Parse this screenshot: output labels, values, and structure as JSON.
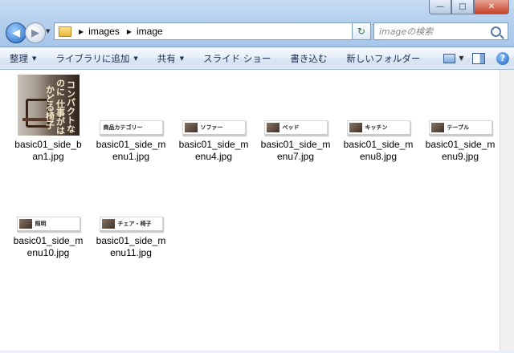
{
  "window": {
    "buttons": {
      "minimize": "—",
      "maximize": "□",
      "close": "✕"
    }
  },
  "nav": {
    "back": "◀",
    "forward": "▶",
    "recent": "▼"
  },
  "address": {
    "icon": "folder-icon",
    "crumbs": [
      "images",
      "image"
    ],
    "separator": "▶",
    "dropdown": "▼"
  },
  "refresh_icon": "↻",
  "search": {
    "placeholder": "imageの検索"
  },
  "toolbar": {
    "items": [
      {
        "label": "整理",
        "has_menu": true
      },
      {
        "label": "ライブラリに追加",
        "has_menu": true
      },
      {
        "label": "共有",
        "has_menu": true
      },
      {
        "label": "スライド ショー",
        "has_menu": false
      },
      {
        "label": "書き込む",
        "has_menu": false
      },
      {
        "label": "新しいフォルダー",
        "has_menu": false
      }
    ],
    "menu_arrow": "▼",
    "view_arrow": "▼",
    "help": "?"
  },
  "files": [
    {
      "name": "basic01_side_ban1.jpg",
      "thumb": "banner",
      "thumb_text": "コンパクトなのに 仕事がはかどる椅子"
    },
    {
      "name": "basic01_side_menu1.jpg",
      "thumb": "menu",
      "thumb_text": "商品カテゴリー",
      "has_pic": false
    },
    {
      "name": "basic01_side_menu4.jpg",
      "thumb": "menu",
      "thumb_text": "ソファー",
      "has_pic": true
    },
    {
      "name": "basic01_side_menu7.jpg",
      "thumb": "menu",
      "thumb_text": "ベッド",
      "has_pic": true
    },
    {
      "name": "basic01_side_menu8.jpg",
      "thumb": "menu",
      "thumb_text": "キッチン",
      "has_pic": true
    },
    {
      "name": "basic01_side_menu9.jpg",
      "thumb": "menu",
      "thumb_text": "テーブル",
      "has_pic": true
    },
    {
      "name": "basic01_side_menu10.jpg",
      "thumb": "menu",
      "thumb_text": "照明",
      "has_pic": true
    },
    {
      "name": "basic01_side_menu11.jpg",
      "thumb": "menu",
      "thumb_text": "チェア・椅子",
      "has_pic": true
    }
  ]
}
